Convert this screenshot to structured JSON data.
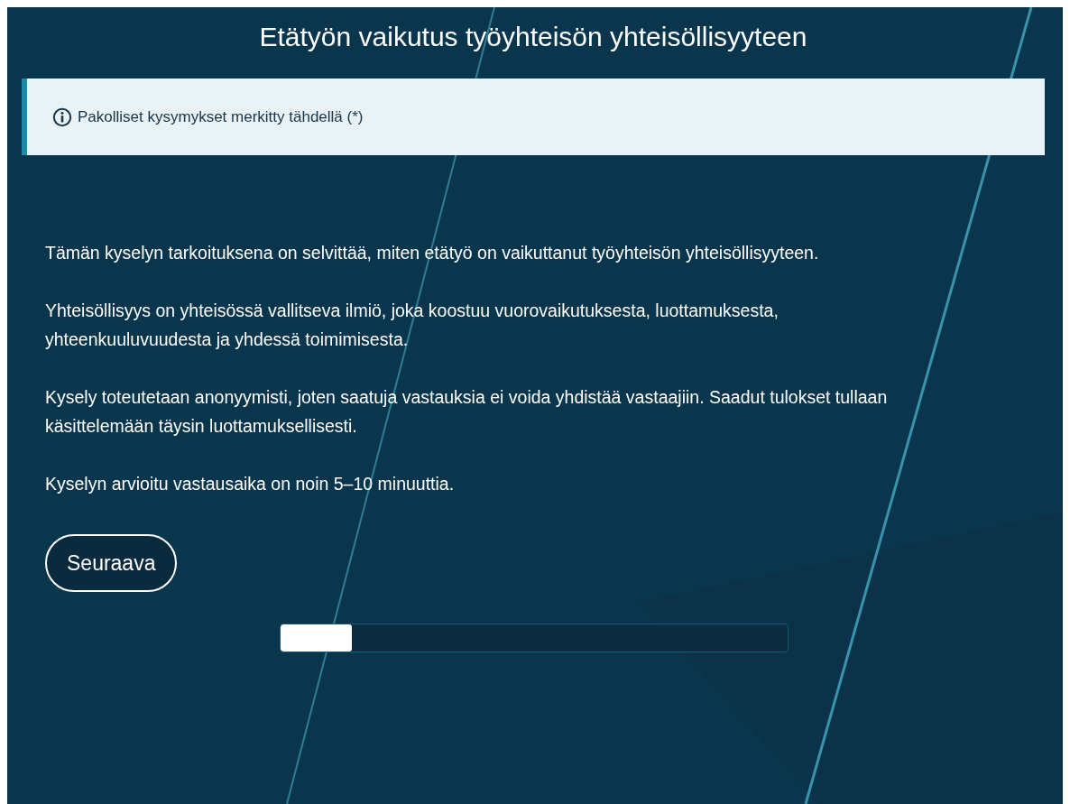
{
  "title": "Etätyön vaikutus työyhteisön yhteisöllisyyteen",
  "notice": {
    "text": "Pakolliset kysymykset merkitty tähdellä (*)"
  },
  "paragraphs": [
    "Tämän kyselyn tarkoituksena on selvittää, miten etätyö on vaikuttanut työyhteisön yhteisöllisyyteen.",
    "Yhteisöllisyys on yhteisössä vallitseva ilmiö, joka koostuu vuorovaikutuksesta, luottamuksesta, yhteenkuuluvuudesta ja yhdessä toimimisesta.",
    "Kysely toteutetaan anonyymisti, joten saatuja vastauksia ei voida yhdistää vastaajiin. Saadut tulokset tullaan käsittelemään täysin luottamuksellisesti.",
    "Kyselyn arvioitu vastausaika on noin 5–10 minuuttia."
  ],
  "next_button": "Seuraava",
  "progress": {
    "level": 0.14
  }
}
